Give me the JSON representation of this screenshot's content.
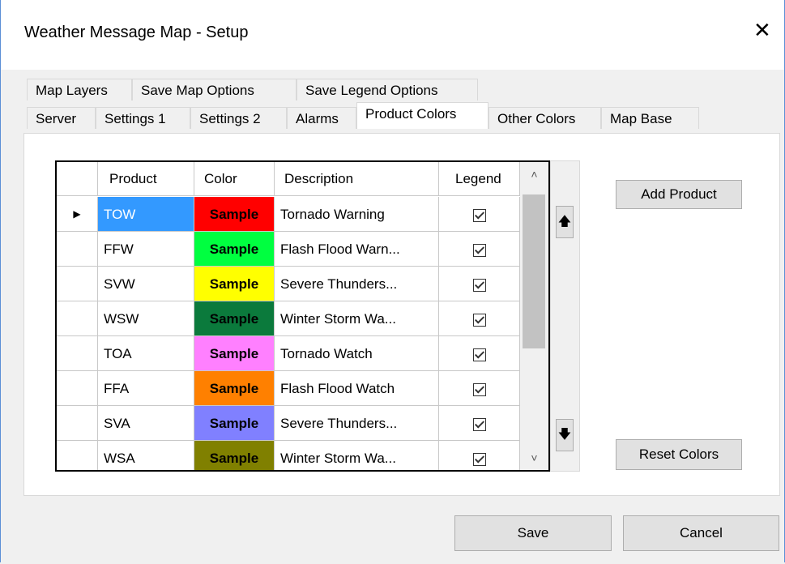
{
  "window": {
    "title": "Weather Message Map - Setup",
    "close_symbol": "✕"
  },
  "tabs_row1": [
    {
      "label": "Map Layers"
    },
    {
      "label": "Save Map Options"
    },
    {
      "label": "Save Legend Options"
    }
  ],
  "tabs_row2": [
    {
      "label": "Server"
    },
    {
      "label": "Settings 1"
    },
    {
      "label": "Settings 2"
    },
    {
      "label": "Alarms"
    },
    {
      "label": "Product Colors",
      "active": true
    },
    {
      "label": "Other Colors"
    },
    {
      "label": "Map Base"
    }
  ],
  "grid": {
    "columns": [
      "Product",
      "Color",
      "Description",
      "Legend"
    ],
    "rows": [
      {
        "product": "TOW",
        "color_label": "Sample",
        "color": "#ff0000",
        "description": "Tornado Warning",
        "legend": true,
        "selected": true
      },
      {
        "product": "FFW",
        "color_label": "Sample",
        "color": "#00ff40",
        "description": "Flash Flood Warn...",
        "legend": true
      },
      {
        "product": "SVW",
        "color_label": "Sample",
        "color": "#ffff00",
        "description": "Severe Thunders...",
        "legend": true
      },
      {
        "product": "WSW",
        "color_label": "Sample",
        "color": "#0b7a3c",
        "description": "Winter Storm Wa...",
        "legend": true
      },
      {
        "product": "TOA",
        "color_label": "Sample",
        "color": "#ff80ff",
        "description": "Tornado Watch",
        "legend": true
      },
      {
        "product": "FFA",
        "color_label": "Sample",
        "color": "#ff8000",
        "description": "Flash Flood Watch",
        "legend": true
      },
      {
        "product": "SVA",
        "color_label": "Sample",
        "color": "#8080ff",
        "description": "Severe Thunders...",
        "legend": true
      },
      {
        "product": "WSA",
        "color_label": "Sample",
        "color": "#808000",
        "description": "Winter Storm Wa...",
        "legend": true
      }
    ]
  },
  "buttons": {
    "add_product": "Add Product",
    "reset_colors": "Reset Colors",
    "save": "Save",
    "cancel": "Cancel",
    "move_up": "🡅",
    "move_down": "🡇"
  },
  "colors": {
    "selected_product_bg": "#3399ff",
    "selected_product_text": "#ffffff"
  }
}
